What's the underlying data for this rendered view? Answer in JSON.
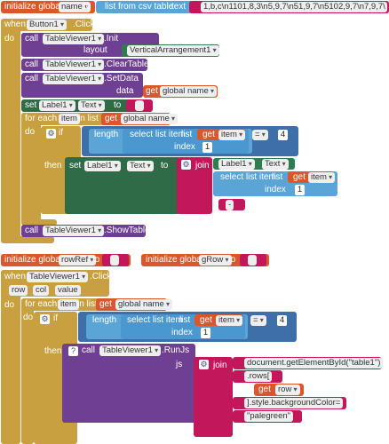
{
  "blocks": {
    "init_name": {
      "keyword": "initialize global",
      "var": "name",
      "to": "to"
    },
    "list_from_csv": {
      "label": "list from csv table",
      "text_kw": "text",
      "csv": "1,b,c\\n1101,8,3\\n5,9,7\\n51,9,7\\n5102,9,7\\n7,9,7\\"
    },
    "button_click": {
      "when": "when",
      "component": "Button1",
      "event": ".Click",
      "do": "do"
    },
    "tv_init": {
      "call": "call",
      "component": "TableViewer1",
      "method": ".Init",
      "layout_kw": "layout",
      "layout_val": "VerticalArrangement1"
    },
    "tv_clear": {
      "call": "call",
      "component": "TableViewer1",
      "method": ".ClearTable"
    },
    "tv_setdata": {
      "call": "call",
      "component": "TableViewer1",
      "method": ".SetData",
      "data_kw": "data",
      "get": "get",
      "var": "global name"
    },
    "set_label": {
      "set": "set",
      "component": "Label1",
      "prop": "Text",
      "to": "to",
      "text": ""
    },
    "foreach1": {
      "kw": "for each",
      "item": "item",
      "in_list": "in list",
      "get": "get",
      "var": "global name",
      "do": "do"
    },
    "if1": {
      "kw": "if",
      "then": "then"
    },
    "length1": {
      "length": "length",
      "select": "select list item",
      "list_kw": "list",
      "get": "get",
      "var": "item",
      "index": "index",
      "index_val": "1",
      "op": "=",
      "rhs": "4"
    },
    "then_set": {
      "set": "set",
      "component": "Label1",
      "prop": "Text",
      "to": "to",
      "join": "join",
      "comp2": "Label1",
      "prop2": "Text",
      "select": "select list item",
      "list_kw": "list",
      "get": "get",
      "var": "item",
      "index": "index",
      "index_val": "1",
      "sep": "-"
    },
    "tv_show": {
      "call": "call",
      "component": "TableViewer1",
      "method": ".ShowTable"
    },
    "init_rowref": {
      "keyword": "initialize global",
      "var": "rowRef",
      "to": "to",
      "text": ""
    },
    "init_grow": {
      "keyword": "initialize global",
      "var": "gRow",
      "to": "to",
      "text": ""
    },
    "tv_click": {
      "when": "when",
      "component": "TableViewer1",
      "event": ".Click",
      "params": [
        "row",
        "col",
        "value"
      ],
      "do": "do"
    },
    "foreach2": {
      "kw": "for each",
      "item": "item",
      "in_list": "in list",
      "get": "get",
      "var": "global name",
      "do": "do"
    },
    "if2": {
      "kw": "if",
      "then": "then"
    },
    "length2": {
      "length": "length",
      "select": "select list item",
      "list_kw": "list",
      "get": "get",
      "var": "item",
      "index": "index",
      "index_val": "1",
      "op": "=",
      "rhs": "4"
    },
    "runjs": {
      "call": "call",
      "component": "TableViewer1",
      "method": ".RunJs",
      "js_kw": "js",
      "join": "join",
      "parts": [
        "document.getElementById(\"table1\")",
        ".rows[",
        "get",
        "row",
        "].style.backgroundColor=",
        "\"palegreen\""
      ]
    }
  }
}
